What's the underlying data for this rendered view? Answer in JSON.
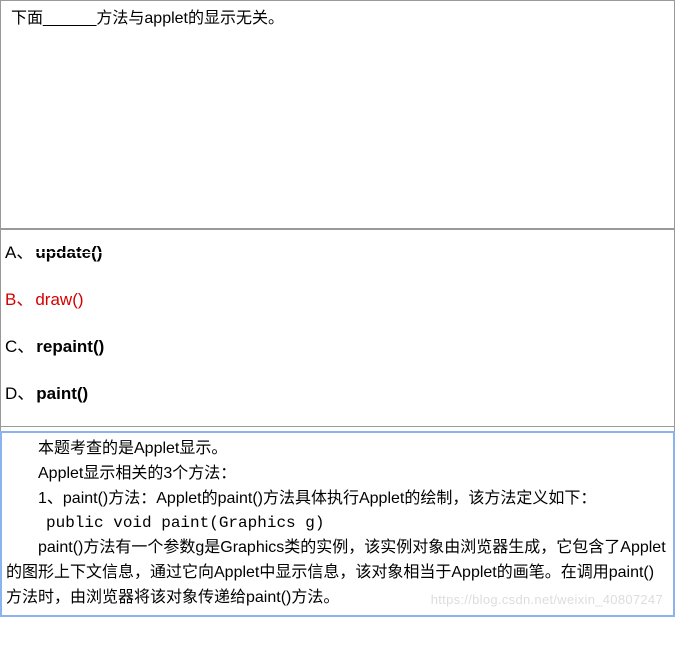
{
  "question": {
    "text": "下面______方法与applet的显示无关。"
  },
  "options": {
    "a": {
      "prefix": "A、",
      "text": "update()"
    },
    "b": {
      "prefix": "B、",
      "text": "draw()"
    },
    "c": {
      "prefix": "C、",
      "text": "repaint()"
    },
    "d": {
      "prefix": "D、",
      "text": "paint()"
    }
  },
  "explanation": {
    "line1": "本题考查的是Applet显示。",
    "line2": "Applet显示相关的3个方法：",
    "line3": "1、paint()方法：Applet的paint()方法具体执行Applet的绘制，该方法定义如下：",
    "line4": "public void paint(Graphics g)",
    "line5": "paint()方法有一个参数g是Graphics类的实例，该实例对象由浏览器生成，它包含了Applet的图形上下文信息，通过它向Applet中显示信息，该对象相当于Applet的画笔。在调用paint()方法时，由浏览器将该对象传递给paint()方法。"
  },
  "watermark": "https://blog.csdn.net/weixin_40807247"
}
